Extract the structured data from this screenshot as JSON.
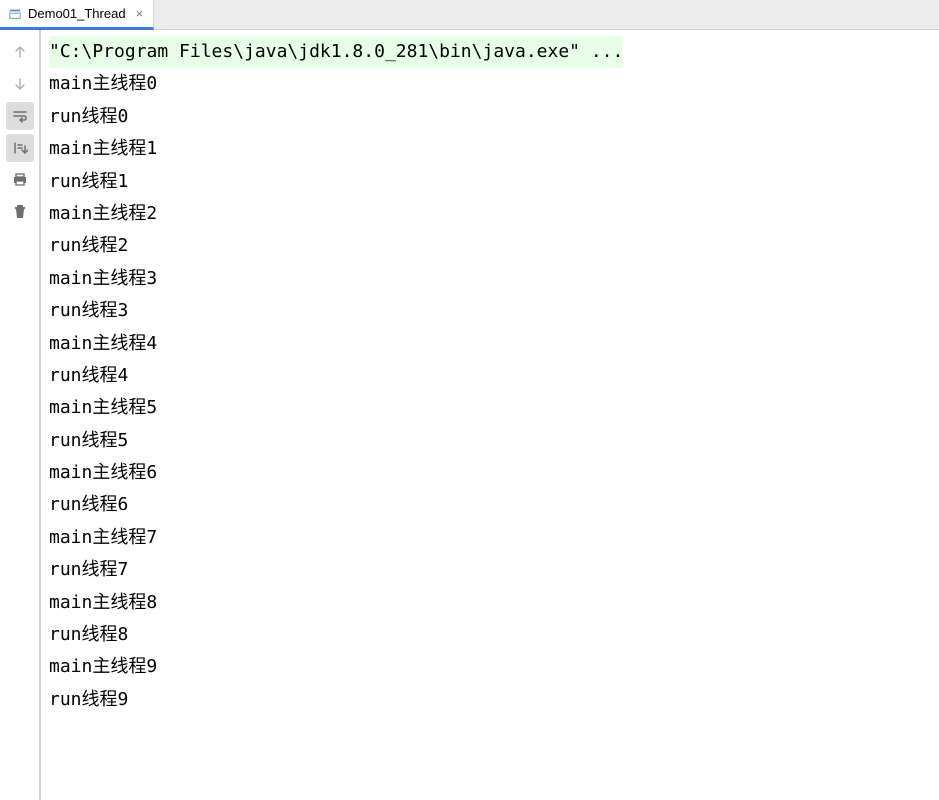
{
  "tab": {
    "title": "Demo01_Thread"
  },
  "console": {
    "command": "\"C:\\Program Files\\java\\jdk1.8.0_281\\bin\\java.exe\" ...",
    "lines": [
      "main主线程0",
      "run线程0",
      "main主线程1",
      "run线程1",
      "main主线程2",
      "run线程2",
      "main主线程3",
      "run线程3",
      "main主线程4",
      "run线程4",
      "main主线程5",
      "run线程5",
      "main主线程6",
      "run线程6",
      "main主线程7",
      "run线程7",
      "main主线程8",
      "run线程8",
      "main主线程9",
      "run线程9"
    ]
  }
}
